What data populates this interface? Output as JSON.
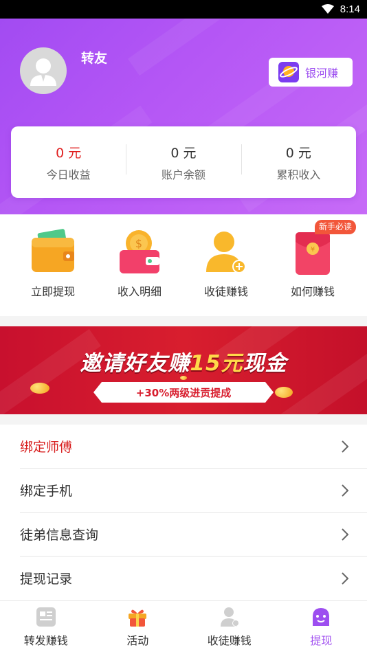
{
  "status_bar": {
    "time": "8:14"
  },
  "profile": {
    "username": "转友"
  },
  "galaxy_button": {
    "label": "银河赚"
  },
  "stats": [
    {
      "value": "0 元",
      "label": "今日收益"
    },
    {
      "value": "0 元",
      "label": "账户余额"
    },
    {
      "value": "0 元",
      "label": "累积收入"
    }
  ],
  "actions": [
    {
      "label": "立即提现"
    },
    {
      "label": "收入明细"
    },
    {
      "label": "收徒赚钱"
    },
    {
      "label": "如何赚钱"
    }
  ],
  "newbie_badge": "新手必读",
  "banner": {
    "title_prefix": "邀请好友赚",
    "title_highlight": "15元",
    "title_suffix": "现金",
    "subtitle": "+30%两级进贡提成"
  },
  "menu": [
    {
      "label": "绑定师傅"
    },
    {
      "label": "绑定手机"
    },
    {
      "label": "徒弟信息查询"
    },
    {
      "label": "提现记录"
    }
  ],
  "tabs": [
    {
      "label": "转发赚钱"
    },
    {
      "label": "活动"
    },
    {
      "label": "收徒赚钱"
    },
    {
      "label": "提现"
    }
  ],
  "colors": {
    "accent": "#a456f0",
    "header_bg": "#b456f5",
    "highlight_red": "#e02020",
    "banner_red": "#d81e2e"
  }
}
